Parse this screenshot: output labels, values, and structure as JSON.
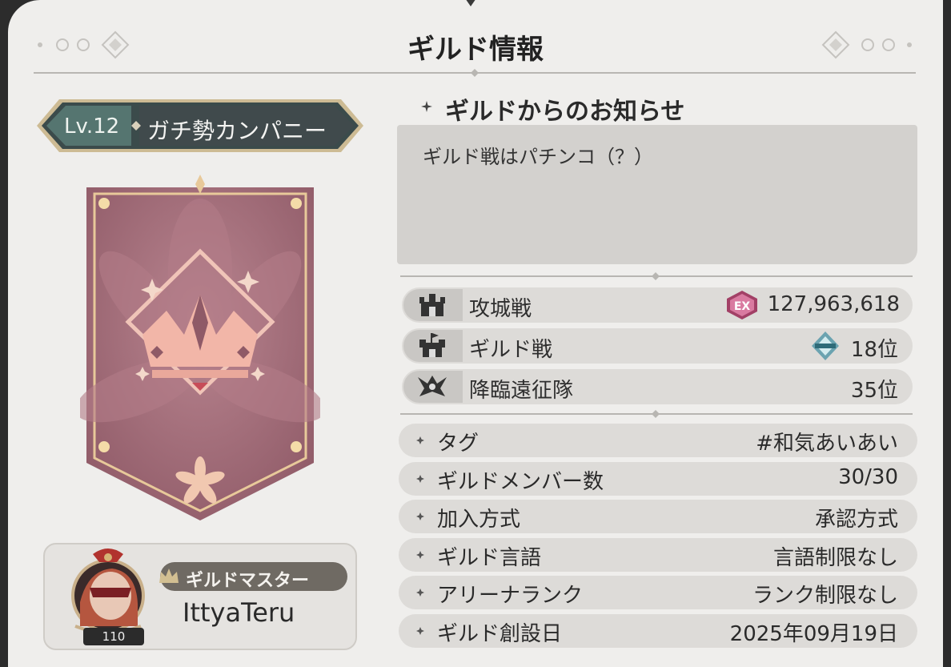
{
  "title": "ギルド情報",
  "guild": {
    "level": "Lv.12",
    "name": "ガチ勢カンパニー"
  },
  "master": {
    "label": "ギルドマスター",
    "name": "IttyaTeru",
    "player_level": "110"
  },
  "notice": {
    "heading": "ギルドからのお知らせ",
    "text": "ギルド戦はパチンコ（？）"
  },
  "stats": [
    {
      "icon": "castle-siege-icon",
      "label": "攻城戦",
      "badge": "EX",
      "value": "127,963,618"
    },
    {
      "icon": "guild-war-icon",
      "label": "ギルド戦",
      "badge": "rank-badge-icon",
      "value": "18位"
    },
    {
      "icon": "expedition-icon",
      "label": "降臨遠征隊",
      "badge": "",
      "value": "35位"
    }
  ],
  "info": [
    {
      "label": "タグ",
      "value": "#和気あいあい"
    },
    {
      "label": "ギルドメンバー数",
      "value": "30/30"
    },
    {
      "label": "加入方式",
      "value": "承認方式"
    },
    {
      "label": "ギルド言語",
      "value": "言語制限なし"
    },
    {
      "label": "アリーナランク",
      "value": "ランク制限なし"
    },
    {
      "label": "ギルド創設日",
      "value": "2025年09月19日"
    }
  ],
  "colors": {
    "panel": "#efeeec",
    "banner_teal": "#3f5a5a",
    "emblem": "#a26f7c",
    "accent_gold": "#d9b982",
    "row": "#dddbd8"
  }
}
